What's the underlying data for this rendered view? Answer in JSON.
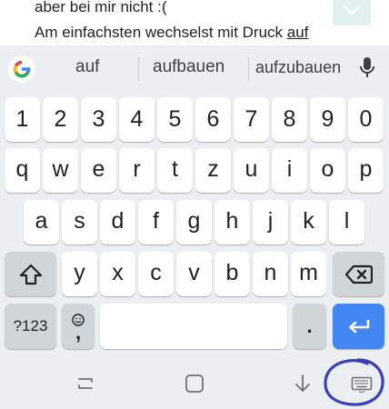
{
  "message": {
    "line1": "aber bei mir nicht :(",
    "line2_prefix": "Am einfachsten wechselst mit Druck ",
    "line2_underlined": "auf"
  },
  "suggestions": [
    "auf",
    "aufbauen",
    "aufzubauen"
  ],
  "keyboard": {
    "number_row": [
      "1",
      "2",
      "3",
      "4",
      "5",
      "6",
      "7",
      "8",
      "9",
      "0"
    ],
    "row1": [
      "q",
      "w",
      "e",
      "r",
      "t",
      "z",
      "u",
      "i",
      "o",
      "p"
    ],
    "row2": [
      "a",
      "s",
      "d",
      "f",
      "g",
      "h",
      "j",
      "k",
      "l"
    ],
    "row3": [
      "y",
      "x",
      "c",
      "v",
      "b",
      "n",
      "m"
    ],
    "symbols_label": "?123",
    "comma_label": ",",
    "period_label": ".",
    "accent_color": "#4286f4"
  },
  "nav": {
    "icons": [
      "recent-apps-icon",
      "home-icon",
      "back-icon",
      "keyboard-icon"
    ]
  },
  "annotation_color": "#3a3fb8"
}
